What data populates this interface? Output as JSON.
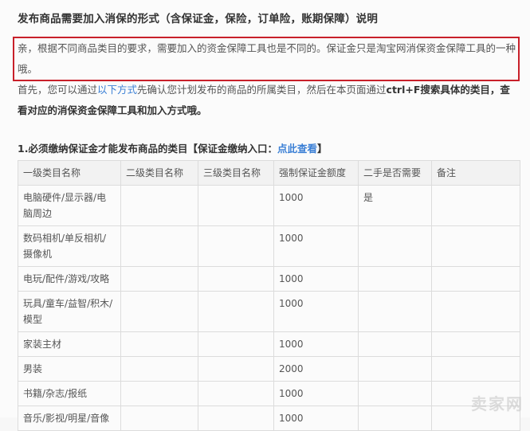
{
  "title": "发布商品需要加入消保的形式（含保证金，保险，订单险，账期保障）说明",
  "notice_text": "亲，根据不同商品类目的要求，需要加入的资金保障工具也是不同的。保证金只是淘宝网消保资金保障工具的一种哦。",
  "intro": {
    "prefix": "首先，您可以通过",
    "link": "以下方式",
    "middle": "先确认您计划发布的商品的所属类目，然后在本页面通过",
    "shortcut": "ctrl+F搜索具体的类目，查看对应的消保资金保障工具和加入方式哦。"
  },
  "section": {
    "title": "1.必须缴纳保证金才能发布商品的类目【保证金缴纳入口：",
    "link": "点此查看",
    "suffix": "】"
  },
  "table": {
    "headers": [
      "一级类目名称",
      "二级类目名称",
      "三级类目名称",
      "强制保证金额度",
      "二手是否需要",
      "备注"
    ],
    "rows": [
      [
        "电脑硬件/显示器/电脑周边",
        "",
        "",
        "1000",
        "是",
        ""
      ],
      [
        "数码相机/单反相机/摄像机",
        "",
        "",
        "1000",
        "",
        ""
      ],
      [
        "电玩/配件/游戏/攻略",
        "",
        "",
        "1000",
        "",
        ""
      ],
      [
        "玩具/童车/益智/积木/模型",
        "",
        "",
        "1000",
        "",
        ""
      ],
      [
        "家装主材",
        "",
        "",
        "1000",
        "",
        ""
      ],
      [
        "男装",
        "",
        "",
        "2000",
        "",
        ""
      ],
      [
        "书籍/杂志/报纸",
        "",
        "",
        "1000",
        "",
        ""
      ],
      [
        "音乐/影视/明星/音像",
        "",
        "",
        "1000",
        "",
        ""
      ]
    ]
  },
  "watermark": "卖家网",
  "colors": {
    "highlight_border": "#c8202a",
    "link": "#3a7fd5"
  }
}
